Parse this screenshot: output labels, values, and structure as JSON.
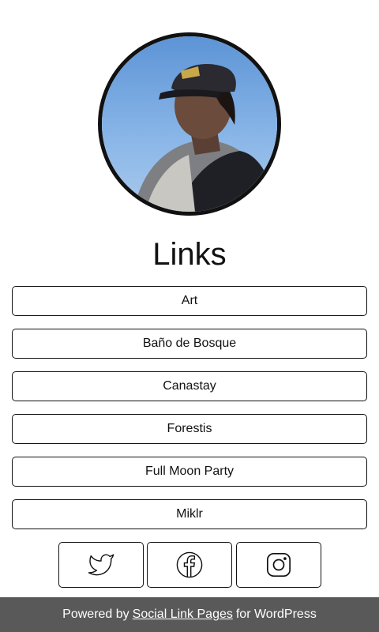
{
  "profile": {
    "title": "Links"
  },
  "links": [
    {
      "label": "Art"
    },
    {
      "label": "Baño de Bosque"
    },
    {
      "label": "Canastay"
    },
    {
      "label": "Forestis"
    },
    {
      "label": "Full Moon Party"
    },
    {
      "label": "Miklr"
    }
  ],
  "social": [
    {
      "icon": "twitter-icon"
    },
    {
      "icon": "facebook-icon"
    },
    {
      "icon": "instagram-icon"
    }
  ],
  "footer": {
    "prefix": "Powered by",
    "link_label": "Social Link Pages",
    "suffix": "for WordPress"
  },
  "colors": {
    "border": "#111111",
    "footer_bg": "#595959",
    "footer_text": "#ffffff",
    "sky": "#6fa3dd"
  }
}
